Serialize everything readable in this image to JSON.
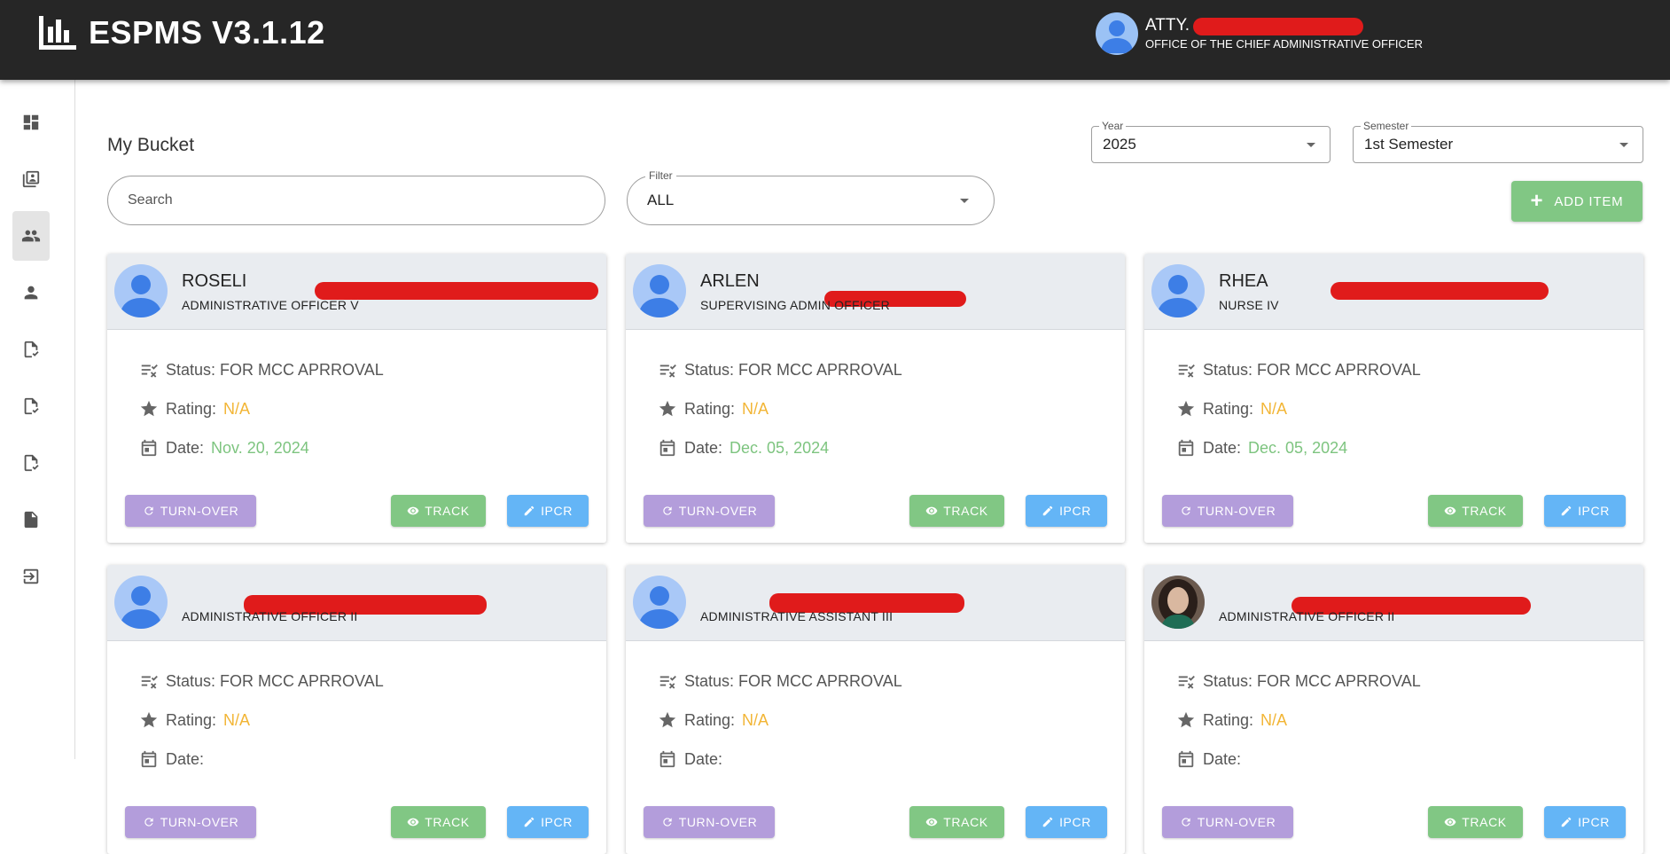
{
  "header": {
    "app_title": "ESPMS V3.1.12",
    "user_name": "ATTY. ",
    "user_office": "OFFICE OF THE CHIEF ADMINISTRATIVE OFFICER"
  },
  "sidebar": {
    "items": [
      {
        "icon": "dashboard-icon"
      },
      {
        "icon": "library-books-icon"
      },
      {
        "icon": "people-icon",
        "active": true
      },
      {
        "icon": "person-icon"
      },
      {
        "icon": "file-check-icon"
      },
      {
        "icon": "file-check-icon"
      },
      {
        "icon": "file-check-icon"
      },
      {
        "icon": "document-icon"
      },
      {
        "icon": "logout-icon"
      }
    ]
  },
  "main": {
    "title": "My Bucket",
    "year": {
      "label": "Year",
      "value": "2025"
    },
    "semester": {
      "label": "Semester",
      "value": "1st Semester"
    },
    "search": {
      "placeholder": "Search"
    },
    "filter": {
      "label": "Filter",
      "value": "ALL"
    },
    "add_button": "ADD ITEM"
  },
  "labels": {
    "status": "Status: ",
    "rating": "Rating:",
    "date": "Date:",
    "turn_over": "TURN-OVER",
    "track": "TRACK",
    "ipcr": "IPCR"
  },
  "cards": [
    {
      "name": "ROSELI",
      "position": "ADMINISTRATIVE OFFICER V",
      "status": "FOR MCC APRROVAL",
      "rating": "N/A",
      "date": "Nov. 20, 2024"
    },
    {
      "name": "ARLEN",
      "position": "SUPERVISING ADMIN OFFICER",
      "status": "FOR MCC APRROVAL",
      "rating": "N/A",
      "date": "Dec. 05, 2024"
    },
    {
      "name": "RHEA",
      "position": "NURSE IV",
      "status": "FOR MCC APRROVAL",
      "rating": "N/A",
      "date": "Dec. 05, 2024"
    },
    {
      "name": "",
      "position": "ADMINISTRATIVE OFFICER II",
      "status": "FOR MCC APRROVAL",
      "rating": "N/A",
      "date": ""
    },
    {
      "name": "",
      "position": "ADMINISTRATIVE ASSISTANT III",
      "status": "FOR MCC APRROVAL",
      "rating": "N/A",
      "date": ""
    },
    {
      "name": "",
      "position": "ADMINISTRATIVE OFFICER II",
      "status": "FOR MCC APRROVAL",
      "rating": "N/A",
      "date": ""
    }
  ],
  "colors": {
    "topbar": "#262626",
    "turn_over": "#b39ddb",
    "track": "#81c784",
    "ipcr": "#64b5f6",
    "rating": "#f2b535",
    "date": "#7dc47f"
  }
}
